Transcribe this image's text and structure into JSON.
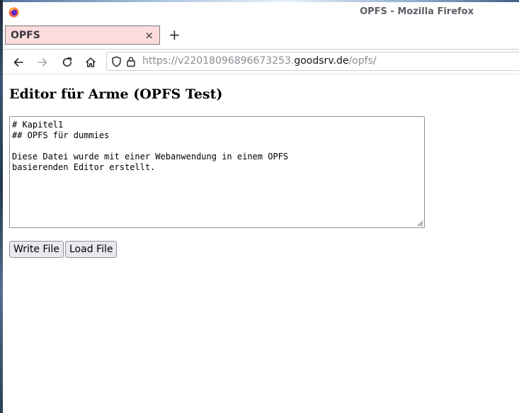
{
  "window": {
    "title": "OPFS - Mozilla Firefox"
  },
  "tabs": [
    {
      "title": "OPFS",
      "close_glyph": "×"
    }
  ],
  "new_tab_glyph": "+",
  "nav": {
    "back_icon": "arrow-left-icon",
    "forward_icon": "arrow-right-icon",
    "reload_icon": "reload-icon",
    "home_icon": "home-icon"
  },
  "url": {
    "scheme": "https://",
    "subdomain": "v22018096896673253.",
    "domain": "goodsrv.de",
    "path": "/opfs/"
  },
  "page": {
    "heading": "Editor für Arme (OPFS Test)",
    "editor_text": "# Kapitel1\n## OPFS für dummies\n\nDiese Datei wurde mit einer Webanwendung in einem OPFS\nbasierenden Editor erstellt.",
    "write_button": "Write File",
    "load_button": "Load File"
  },
  "colors": {
    "tab_active_bg": "#fcdcdc",
    "url_domain": "#15141a",
    "url_dim": "#8c8c94"
  }
}
